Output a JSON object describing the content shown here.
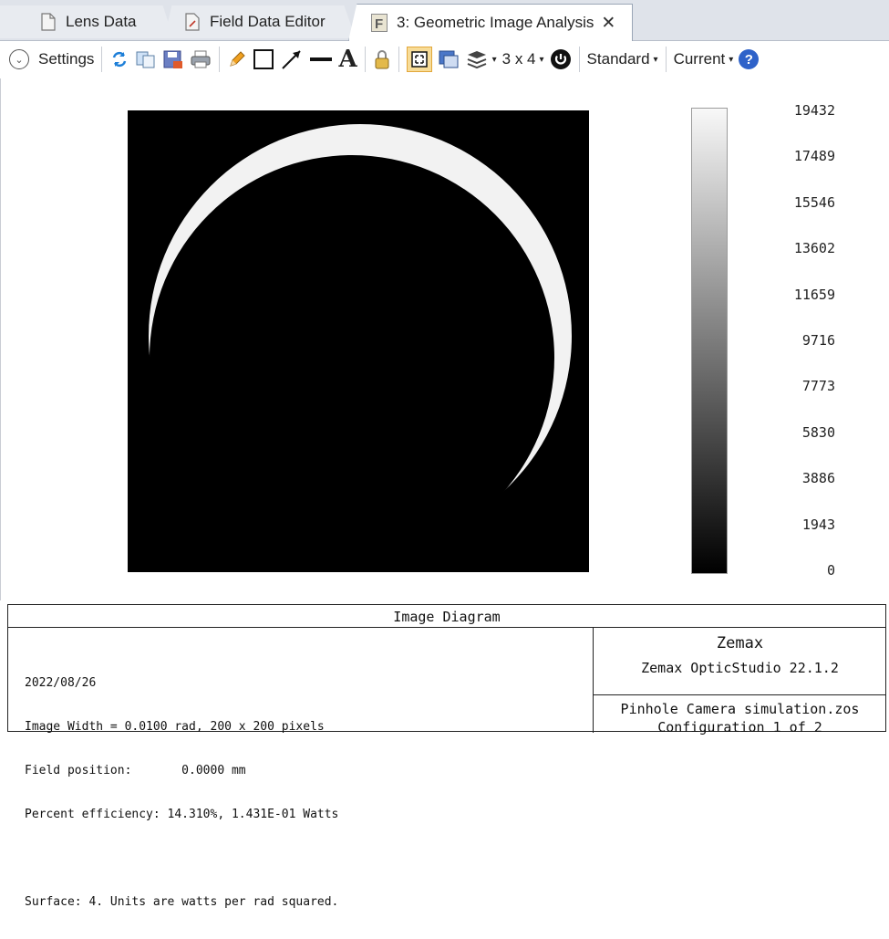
{
  "tabs": [
    {
      "label": "Lens Data",
      "icon": "document-icon"
    },
    {
      "label": "Field Data Editor",
      "icon": "document-edit-icon"
    },
    {
      "label": "3: Geometric Image Analysis",
      "icon": "f-letter-icon"
    }
  ],
  "toolbar": {
    "settings_label": "Settings",
    "layout_label": "3 x 4",
    "standard_label": "Standard",
    "current_label": "Current",
    "icons": [
      "refresh-icon",
      "copy-icon",
      "save-icon",
      "print-icon",
      "pencil-icon",
      "rectangle-icon",
      "arrow-icon",
      "line-icon",
      "text-icon",
      "lock-icon",
      "fit-icon",
      "window-icon",
      "layers-icon",
      "power-icon",
      "help-icon"
    ]
  },
  "colorbar": {
    "ticks": [
      "19432",
      "17489",
      "15546",
      "13602",
      "11659",
      "9716",
      "7773",
      "5830",
      "3886",
      "1943",
      "0"
    ]
  },
  "info": {
    "title": "Image Diagram",
    "lines": [
      "2022/08/26",
      "Image Width = 0.0100 rad, 200 x 200 pixels",
      "Field position:       0.0000 mm",
      "Percent efficiency: 14.310%, 1.431E-01 Watts",
      "",
      "Surface: 4. Units are watts per rad squared."
    ],
    "brand": "Zemax",
    "version": "Zemax OpticStudio 22.1.2",
    "file": "Pinhole Camera simulation.zos",
    "config": "Configuration 1 of 2"
  }
}
